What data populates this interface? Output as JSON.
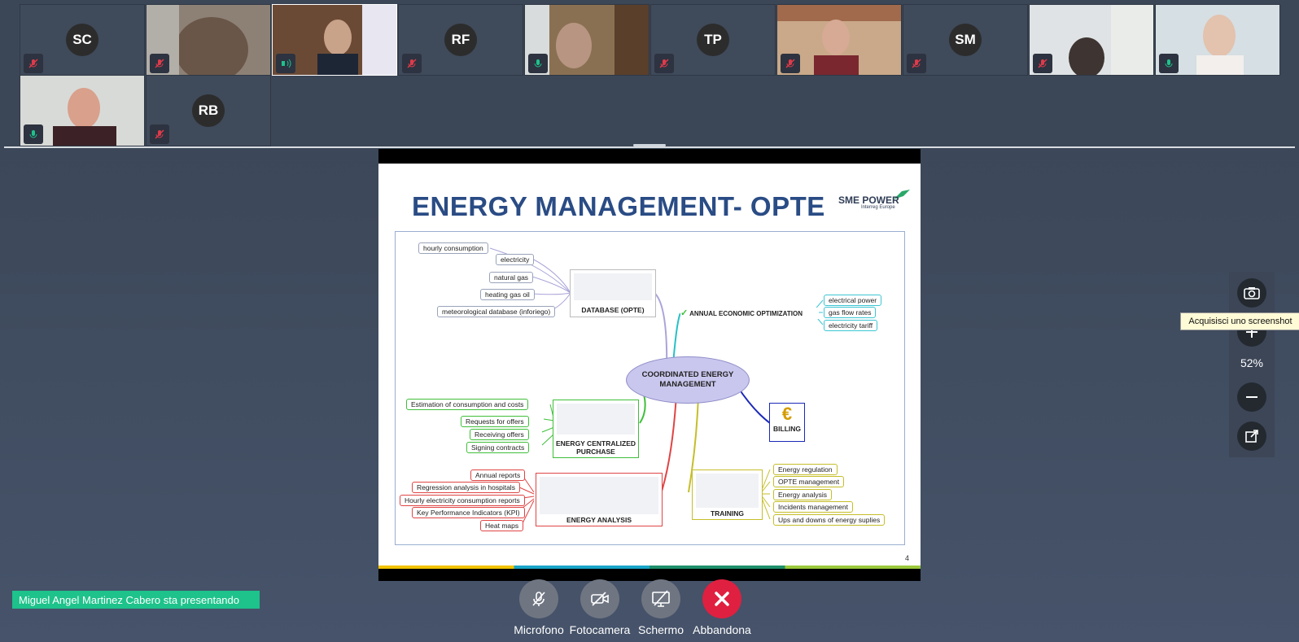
{
  "participants": [
    {
      "initials": "SC",
      "mic": "muted",
      "video": false
    },
    {
      "initials": "",
      "mic": "muted",
      "video": true
    },
    {
      "initials": "",
      "mic": "speaking",
      "video": true
    },
    {
      "initials": "RF",
      "mic": "muted",
      "video": false
    },
    {
      "initials": "",
      "mic": "on",
      "video": true
    },
    {
      "initials": "TP",
      "mic": "muted",
      "video": false
    },
    {
      "initials": "",
      "mic": "muted",
      "video": true
    },
    {
      "initials": "SM",
      "mic": "muted",
      "video": false
    },
    {
      "initials": "",
      "mic": "muted",
      "video": true
    },
    {
      "initials": "",
      "mic": "on",
      "video": true
    },
    {
      "initials": "",
      "mic": "on",
      "video": true
    },
    {
      "initials": "RB",
      "mic": "muted",
      "video": false
    }
  ],
  "slide": {
    "title": "ENERGY MANAGEMENT- OPTE",
    "logo_main": "SME POWER",
    "logo_sub": "Interreg Europe",
    "page": "4",
    "center": "COORDINATED ENERGY MANAGEMENT",
    "database": {
      "title": "DATABASE  (OPTE)",
      "items": [
        "hourly  consumption",
        "electricity",
        "natural gas",
        "heating gas oil",
        "meteorological database (inforiego)"
      ]
    },
    "annual": {
      "title": "ANNUAL ECONOMIC OPTIMIZATION",
      "items": [
        "electrical power",
        "gas flow rates",
        "electricity tariff"
      ]
    },
    "purchase": {
      "title": "ENERGY CENTRALIZED PURCHASE",
      "items": [
        "Estimation of consumption and costs",
        "Requests for offers",
        "Receiving offers",
        "Signing contracts"
      ]
    },
    "analysis": {
      "title": "ENERGY ANALYSIS",
      "items": [
        "Annual reports",
        "Regression analysis in hospitals",
        "Hourly electricity consumption reports",
        "Key Performance Indicators (KPI)",
        "Heat maps"
      ]
    },
    "billing": {
      "title": "BILLING"
    },
    "training": {
      "title": "TRAINING",
      "items": [
        "Energy regulation",
        "OPTE management",
        "Energy analysis",
        "Incidents  management",
        "Ups and downs of energy suplies"
      ]
    }
  },
  "zoom": {
    "level": "52%",
    "tooltip": "Acquisisci uno screenshot"
  },
  "presenter_banner": "Miguel Angel Martinez Cabero sta presentando",
  "controls": {
    "mic": "Microfono",
    "camera": "Fotocamera",
    "screen": "Schermo",
    "leave": "Abbandona"
  },
  "colors": {
    "accent": "#1ec28b",
    "leave": "#e02040",
    "muted": "#e03a4a",
    "mic_on": "#1ec28b"
  }
}
